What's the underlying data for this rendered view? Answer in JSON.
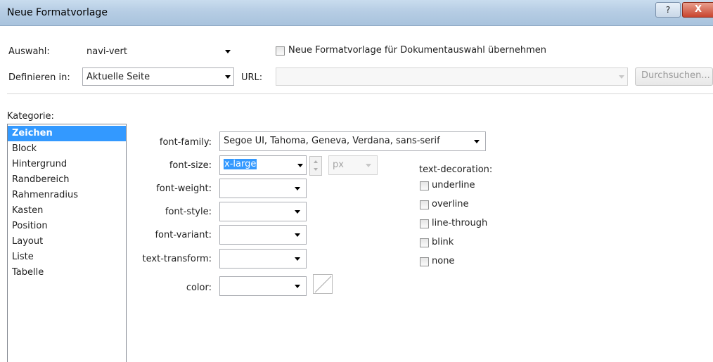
{
  "window": {
    "title": "Neue Formatvorlage",
    "help_glyph": "?",
    "close_glyph": "X"
  },
  "top": {
    "auswahl_label": "Auswahl:",
    "auswahl_value": "navi-vert",
    "checkbox_label": "Neue Formatvorlage für Dokumentauswahl übernehmen",
    "definieren_label": "Definieren in:",
    "definieren_value": "Aktuelle Seite",
    "url_label": "URL:",
    "url_value": "",
    "browse_label": "Durchsuchen..."
  },
  "kategorie": {
    "label": "Kategorie:",
    "items": [
      "Zeichen",
      "Block",
      "Hintergrund",
      "Randbereich",
      "Rahmenradius",
      "Kasten",
      "Position",
      "Layout",
      "Liste",
      "Tabelle"
    ],
    "selected": "Zeichen"
  },
  "props": {
    "font_family_label": "font-family:",
    "font_family_value": "Segoe UI, Tahoma, Geneva, Verdana, sans-serif",
    "font_size_label": "font-size:",
    "font_size_value": "x-large",
    "font_size_unit": "px",
    "font_weight_label": "font-weight:",
    "font_style_label": "font-style:",
    "font_variant_label": "font-variant:",
    "text_transform_label": "text-transform:",
    "color_label": "color:"
  },
  "text_decoration": {
    "label": "text-decoration:",
    "options": [
      "underline",
      "overline",
      "line-through",
      "blink",
      "none"
    ]
  }
}
